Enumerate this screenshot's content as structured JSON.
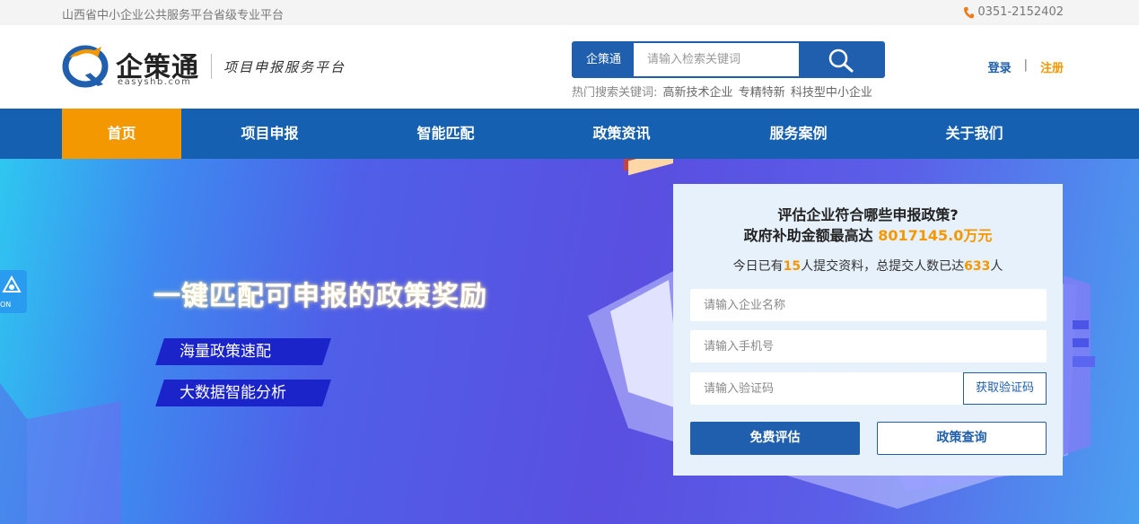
{
  "topbar": {
    "platform_name": "山西省中小企业公共服务平台省级专业平台",
    "phone": "0351-2152402",
    "phone_icon": "phone-icon"
  },
  "header": {
    "logo_name": "企策通",
    "logo_domain": "easyshb.com",
    "logo_slogan": "项目申报服务平台",
    "search_tag": "企策通",
    "search_placeholder": "请输入检索关键词",
    "search_icon": "search-icon",
    "hot_label": "热门搜索关键词:",
    "hot_keywords": [
      "高新技术企业",
      "专精特新",
      "科技型中小企业"
    ],
    "login_label": "登录",
    "separator": "|",
    "register_label": "注册"
  },
  "nav": {
    "items": [
      {
        "label": "首页",
        "active": true
      },
      {
        "label": "项目申报",
        "active": false
      },
      {
        "label": "智能匹配",
        "active": false
      },
      {
        "label": "政策资讯",
        "active": false
      },
      {
        "label": "服务案例",
        "active": false
      },
      {
        "label": "关于我们",
        "active": false
      }
    ]
  },
  "hero": {
    "title": "一键匹配可申报的政策奖励",
    "badges": [
      "海量政策速配",
      "大数据智能分析"
    ],
    "side_widget_text": "ON"
  },
  "form": {
    "question": "评估企业符合哪些申报政策?",
    "amount_prefix": "政府补助金额最高达",
    "amount": "8017145.0万元",
    "stat_prefix": "今日已有",
    "today_count": "15",
    "stat_middle": "人提交资料，总提交人数已达",
    "total_count": "633",
    "stat_suffix": "人",
    "company_placeholder": "请输入企业名称",
    "phone_placeholder": "请输入手机号",
    "code_placeholder": "请输入验证码",
    "get_code_label": "获取验证码",
    "evaluate_label": "免费评估",
    "policy_query_label": "政策查询"
  },
  "colors": {
    "brand_blue": "#1f5fad",
    "nav_blue": "#1560b0",
    "accent_orange": "#f39800"
  }
}
